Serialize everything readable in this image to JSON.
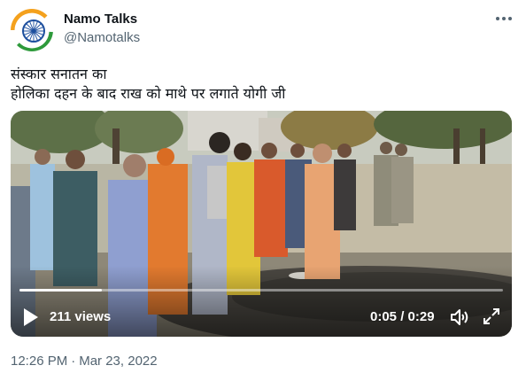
{
  "author": {
    "display_name": "Namo Talks",
    "handle": "@Namotalks",
    "avatar_icon": "chakra-avatar-icon"
  },
  "tweet": {
    "line1": "संस्कार सनातन का",
    "line2": "होलिका दहन के बाद राख को माथे पर लगाते योगी जी"
  },
  "video": {
    "views": "211 views",
    "current_time": "0:05",
    "separator": "/",
    "duration": "0:29",
    "progress_fraction": 0.17
  },
  "footer": {
    "time": "12:26 PM",
    "dot": "·",
    "date": "Mar 23, 2022"
  },
  "icons": {
    "more": "more-options-icon",
    "play": "play-icon",
    "volume": "volume-icon",
    "fullscreen": "fullscreen-icon"
  },
  "colors": {
    "text_primary": "#0f1419",
    "text_secondary": "#536471",
    "video_overlay_text": "#ffffff"
  }
}
